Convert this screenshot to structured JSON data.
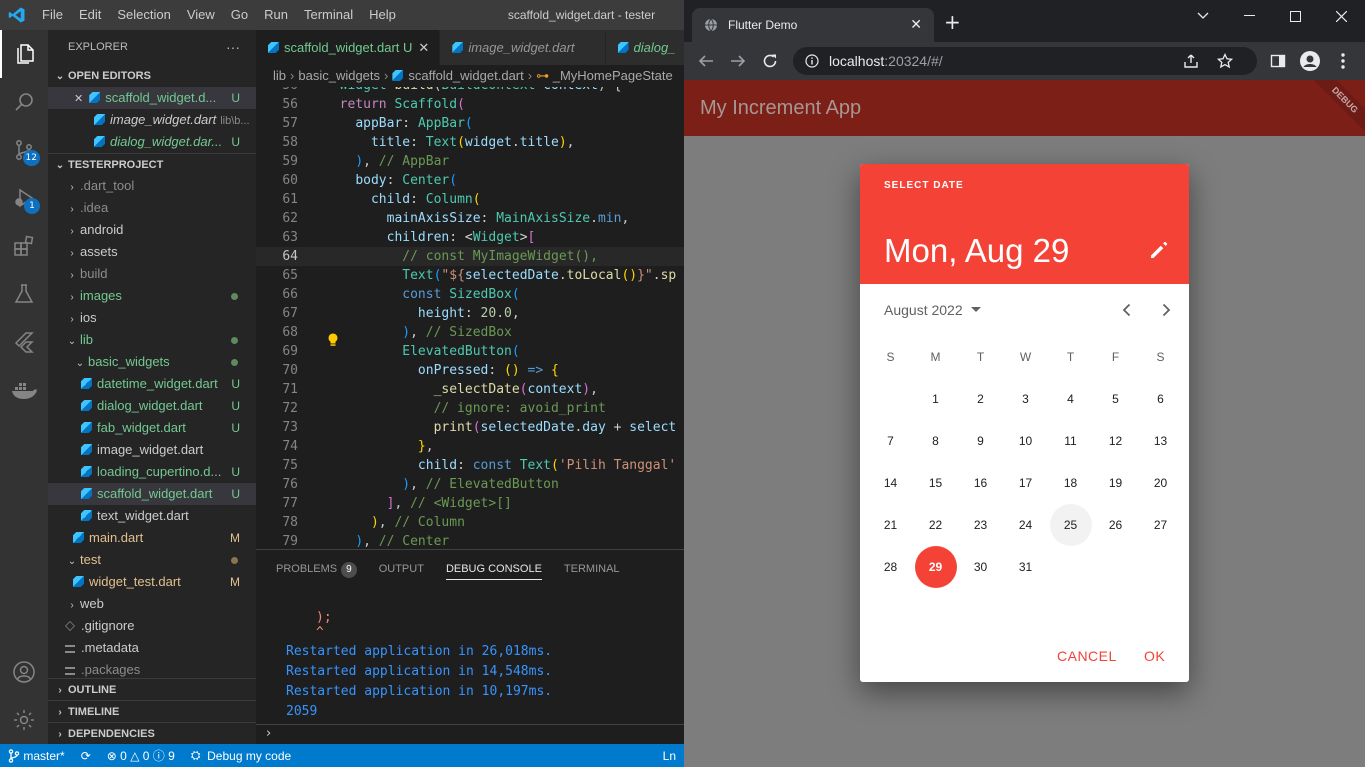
{
  "vscode": {
    "menu": [
      "File",
      "Edit",
      "Selection",
      "View",
      "Go",
      "Run",
      "Terminal",
      "Help"
    ],
    "window_title": "scaffold_widget.dart - tester",
    "activity_badges": {
      "scm": "12",
      "debug": "1"
    },
    "explorer": {
      "title": "EXPLORER",
      "more": "···",
      "open_editors_header": "OPEN EDITORS",
      "open_editors": [
        {
          "name": "scaffold_widget.d...",
          "status": "U",
          "close": "✕"
        },
        {
          "name": "image_widget.dart",
          "dim": "lib\\b...",
          "status": ""
        },
        {
          "name": "dialog_widget.dar...",
          "status": "U"
        }
      ],
      "project_header": "TESTERPROJECT",
      "tree": [
        {
          "name": ".dart_tool",
          "chev": "›"
        },
        {
          "name": ".idea",
          "chev": "›"
        },
        {
          "name": "android",
          "chev": "›"
        },
        {
          "name": "assets",
          "chev": "›"
        },
        {
          "name": "build",
          "chev": "›"
        },
        {
          "name": "images",
          "chev": "›"
        },
        {
          "name": "ios",
          "chev": "›"
        },
        {
          "name": "lib",
          "chev": "⌄"
        },
        {
          "name": "basic_widgets",
          "chev": "⌄"
        },
        {
          "name": "datetime_widget.dart",
          "status": "U"
        },
        {
          "name": "dialog_widget.dart",
          "status": "U"
        },
        {
          "name": "fab_widget.dart",
          "status": "U"
        },
        {
          "name": "image_widget.dart",
          "status": ""
        },
        {
          "name": "loading_cupertino.d...",
          "status": "U"
        },
        {
          "name": "scaffold_widget.dart",
          "status": "U"
        },
        {
          "name": "text_widget.dart",
          "status": ""
        },
        {
          "name": "main.dart",
          "status": "M"
        },
        {
          "name": "test",
          "chev": "⌄"
        },
        {
          "name": "widget_test.dart",
          "status": "M"
        },
        {
          "name": "web",
          "chev": "›"
        },
        {
          "name": ".gitignore"
        },
        {
          "name": ".metadata"
        },
        {
          "name": ".packages"
        }
      ],
      "outline": "OUTLINE",
      "timeline": "TIMELINE",
      "dependencies": "DEPENDENCIES"
    },
    "tabs": [
      {
        "name": "scaffold_widget.dart",
        "status": "U",
        "close": "✕"
      },
      {
        "name": "image_widget.dart"
      },
      {
        "name": "dialog_"
      }
    ],
    "breadcrumb": [
      "lib",
      "basic_widgets",
      "scaffold_widget.dart",
      "_MyHomePageState"
    ],
    "line_numbers": [
      "56",
      "57",
      "58",
      "59",
      "60",
      "61",
      "62",
      "63",
      "64",
      "65",
      "66",
      "67",
      "68",
      "69",
      "70",
      "71",
      "72",
      "73",
      "74",
      "75",
      "76",
      "77",
      "78",
      "79"
    ],
    "panel": {
      "tabs": [
        "PROBLEMS",
        "OUTPUT",
        "DEBUG CONSOLE",
        "TERMINAL"
      ],
      "problems_count": "9",
      "console": [
        ");",
        "^",
        "Restarted application in 26,018ms.",
        "Restarted application in 14,548ms.",
        "Restarted application in 10,197ms.",
        "2059"
      ],
      "prompt": "›"
    },
    "status": {
      "branch": "master*",
      "errors": "0",
      "warnings": "0",
      "info": "9",
      "debug": "Debug my code",
      "ln": "Ln"
    }
  },
  "chrome": {
    "tab_title": "Flutter Demo",
    "tab_close": "✕",
    "new_tab": "+",
    "url_host": "localhost",
    "url_rest": ":20324/#/",
    "app_title": "My Increment App",
    "debug_banner": "DEBUG",
    "date_picker": {
      "help_text": "SELECT DATE",
      "selected_text": "Mon, Aug 29",
      "month_label": "August 2022",
      "weekdays": [
        "S",
        "M",
        "T",
        "W",
        "T",
        "F",
        "S"
      ],
      "first_weekday_offset": 1,
      "days": [
        "1",
        "2",
        "3",
        "4",
        "5",
        "6",
        "7",
        "8",
        "9",
        "10",
        "11",
        "12",
        "13",
        "14",
        "15",
        "16",
        "17",
        "18",
        "19",
        "20",
        "21",
        "22",
        "23",
        "24",
        "25",
        "26",
        "27",
        "28",
        "29",
        "30",
        "31"
      ],
      "today": 25,
      "selected": 29,
      "cancel": "CANCEL",
      "ok": "OK",
      "accent": "#f44336"
    }
  }
}
